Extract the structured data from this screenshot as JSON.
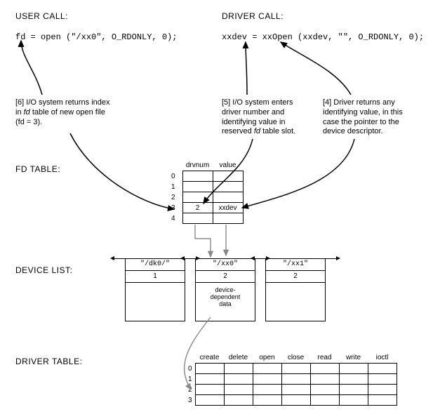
{
  "headings": {
    "user_call": "USER CALL:",
    "driver_call": "DRIVER CALL:",
    "fd_table": "FD TABLE:",
    "device_list": "DEVICE LIST:",
    "driver_table": "DRIVER TABLE:"
  },
  "code": {
    "user_call_line": "fd = open (\"/xx0\", O_RDONLY, 0);",
    "driver_call_line": "xxdev = xxOpen (xxdev, \"\", O_RDONLY, 0);"
  },
  "notes": {
    "n6_prefix": "[6] I/O system returns index in ",
    "n6_italic": "fd",
    "n6_suffix": " table of new open file (fd = 3).",
    "n5_prefix": "[5] I/O system enters driver number and identifying value in reserved ",
    "n5_italic": "fd",
    "n5_suffix": " table slot.",
    "n4": "[4] Driver returns any identifying value, in this case the pointer to the device descriptor."
  },
  "fd_table": {
    "headers": [
      "drvnum",
      "value"
    ],
    "rows": [
      {
        "idx": "0",
        "drvnum": "",
        "value": ""
      },
      {
        "idx": "1",
        "drvnum": "",
        "value": ""
      },
      {
        "idx": "2",
        "drvnum": "",
        "value": ""
      },
      {
        "idx": "3",
        "drvnum": "2",
        "value": "xxdev"
      },
      {
        "idx": "4",
        "drvnum": "",
        "value": ""
      }
    ]
  },
  "device_list": {
    "items": [
      {
        "name": "\"/dk0/\"",
        "num": "1",
        "body": ""
      },
      {
        "name": "\"/xx0\"",
        "num": "2",
        "body": "device-\ndependent\ndata"
      },
      {
        "name": "\"/xx1\"",
        "num": "2",
        "body": ""
      }
    ]
  },
  "driver_table": {
    "headers": [
      "create",
      "delete",
      "open",
      "close",
      "read",
      "write",
      "ioctl"
    ],
    "row_indices": [
      "0",
      "1",
      "2",
      "3"
    ]
  }
}
